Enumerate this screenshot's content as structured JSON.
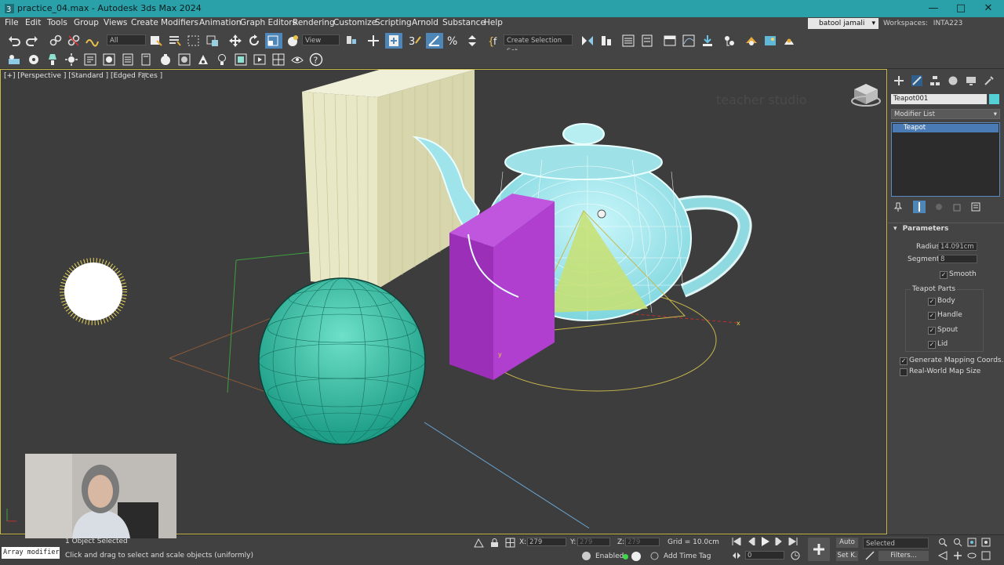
{
  "window": {
    "title": "practice_04.max - Autodesk 3ds Max 2024",
    "controls": [
      "minimize-icon",
      "maximize-icon",
      "close-icon"
    ]
  },
  "menu": {
    "items": [
      "File",
      "Edit",
      "Tools",
      "Group",
      "Views",
      "Create",
      "Modifiers",
      "Animation",
      "Graph Editors",
      "Rendering",
      "Customize",
      "Scripting",
      "Arnold",
      "Substance",
      "Help"
    ],
    "user": "batool jamali",
    "workspaces_label": "Workspaces:",
    "workspace_value": "INTA223"
  },
  "toolbar": {
    "filter_value": "All",
    "ref_coord_value": "View",
    "selection_set_placeholder": "Create Selection Set"
  },
  "viewport": {
    "label": "[+] [Perspective ] [Standard ] [Edged Faces ]",
    "watermark": "teacher studio",
    "axis_x": "x",
    "axis_y": "y"
  },
  "command_panel": {
    "object_name": "Teapot001",
    "object_color": "#55d0d6",
    "modifier_list_label": "Modifier List",
    "stack_item": "Teapot",
    "rollout_title": "Parameters",
    "radius_label": "Radius:",
    "radius_value": "14.091cm",
    "segments_label": "Segments:",
    "segments_value": "8",
    "smooth_label": "Smooth",
    "parts_title": "Teapot Parts",
    "parts": [
      "Body",
      "Handle",
      "Spout",
      "Lid"
    ],
    "gen_mapping_label": "Generate Mapping Coords.",
    "real_world_label": "Real-World Map Size"
  },
  "status": {
    "selected": "1 Object Selected",
    "prompt": "Click and drag to select and scale objects (uniformly)",
    "script_box": "Array modifier",
    "x_label": "X:",
    "x_value": "279",
    "y_label": "Y:",
    "y_value": "279",
    "z_label": "Z:",
    "z_value": "279",
    "grid": "Grid = 10.0cm",
    "enabled": "Enabled:",
    "add_time_tag": "Add Time Tag",
    "auto_label": "Auto",
    "selected_dd": "Selected",
    "setk_label": "Set K.",
    "filters_label": "Filters...",
    "frame_value": "0"
  },
  "colors": {
    "title_bar": "#2aa0a8",
    "teapot": "#8fe3ea",
    "sphere": "#2bb79e",
    "box_purple": "#a43ac0",
    "plane": "#e7e6c4",
    "viewport_border": "#c8b84c"
  }
}
